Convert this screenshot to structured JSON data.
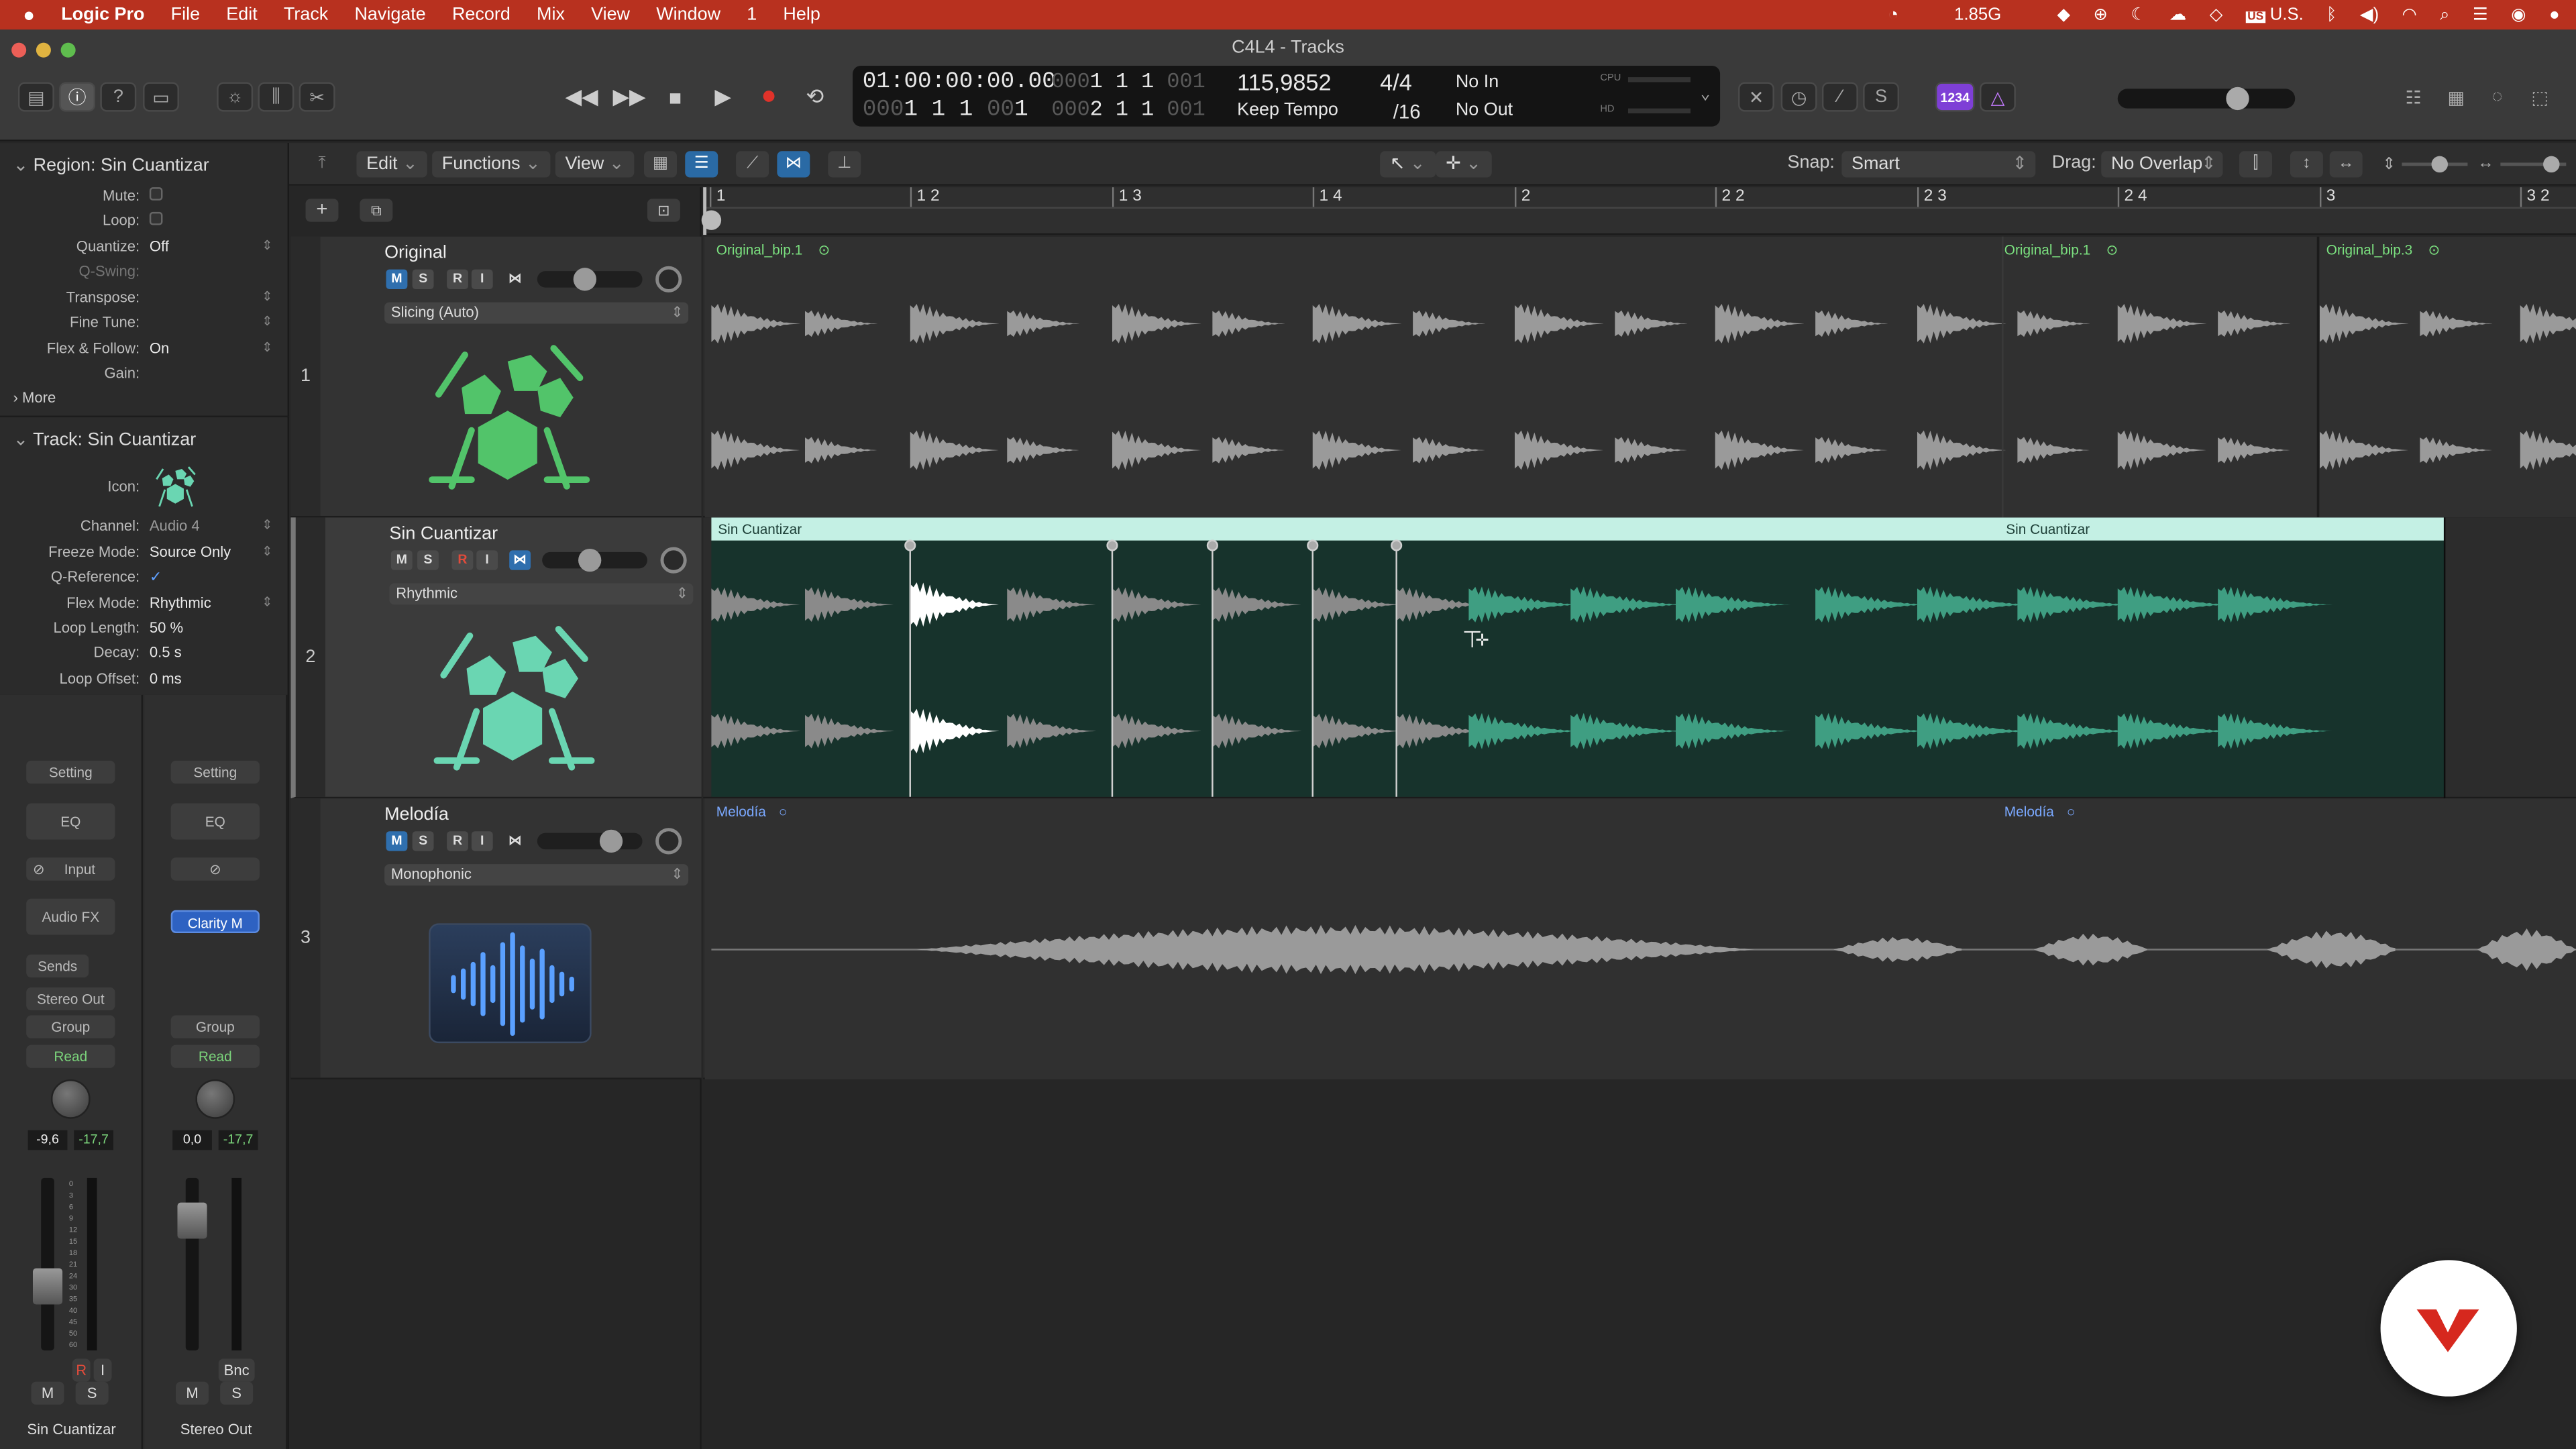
{
  "menubar": {
    "apple": "",
    "app": "Logic Pro",
    "items": [
      "File",
      "Edit",
      "Track",
      "Navigate",
      "Record",
      "Mix",
      "View",
      "Window",
      "1",
      "Help"
    ],
    "memory": "1.85G",
    "input_source": "U.S."
  },
  "window": {
    "title": "C4L4 - Tracks"
  },
  "lcd": {
    "time": "01:00:00:00.00",
    "bars_top": "1  1  1",
    "bars_top_dim": "000",
    "bars_top_tail": "001",
    "bars_bottom": "1  1  1",
    "bars_bottom_dim": "000",
    "bars_bottom_tail": "1",
    "pos2_dim": "000",
    "pos2": "2  1  1",
    "pos2_tail": "001",
    "pos2b_dim": "000",
    "pos2b": "1  1  1",
    "pos2b_tail": "001",
    "tempo": "115,9852",
    "tempo_mode": "Keep Tempo",
    "signature": "4/4",
    "division": "/16",
    "in": "No In",
    "out": "No Out",
    "cpu": "CPU",
    "hd": "HD"
  },
  "lcd_badge": "1234",
  "toolbar": {
    "edit": "Edit",
    "functions": "Functions",
    "view": "View",
    "snap_label": "Snap:",
    "snap_value": "Smart",
    "drag_label": "Drag:",
    "drag_value": "No Overlap"
  },
  "inspector": {
    "region_header": "Region: Sin Cuantizar",
    "region_params": [
      {
        "label": "Mute:",
        "value": ""
      },
      {
        "label": "Loop:",
        "value": ""
      },
      {
        "label": "Quantize:",
        "value": "Off"
      },
      {
        "label": "Q-Swing:",
        "value": ""
      },
      {
        "label": "Transpose:",
        "value": ""
      },
      {
        "label": "Fine Tune:",
        "value": ""
      },
      {
        "label": "Flex & Follow:",
        "value": "On"
      },
      {
        "label": "Gain:",
        "value": ""
      }
    ],
    "more": "More",
    "track_header": "Track: Sin Cuantizar",
    "track_params": [
      {
        "label": "Icon:",
        "value": ""
      },
      {
        "label": "Channel:",
        "value": "Audio 4"
      },
      {
        "label": "Freeze Mode:",
        "value": "Source Only"
      },
      {
        "label": "Q-Reference:",
        "value": "✓"
      },
      {
        "label": "Flex Mode:",
        "value": "Rhythmic"
      },
      {
        "label": "Loop Length:",
        "value": "50 %"
      },
      {
        "label": "Decay:",
        "value": "0.5 s"
      },
      {
        "label": "Loop Offset:",
        "value": "0 ms"
      }
    ]
  },
  "strips": [
    {
      "setting": "Setting",
      "eq": "EQ",
      "input": "Input",
      "fx": "Audio FX",
      "sends": "Sends",
      "output": "Stereo Out",
      "group": "Group",
      "automation": "Read",
      "vol": "-9,6",
      "peak": "-17,7",
      "r": "R",
      "i": "I",
      "m": "M",
      "s": "S",
      "name": "Sin Cuantizar"
    },
    {
      "setting": "Setting",
      "eq": "EQ",
      "plugin": "Clarity M",
      "group": "Group",
      "automation": "Read",
      "vol": "0,0",
      "peak": "-17,7",
      "bnc": "Bnc",
      "m": "M",
      "s": "S",
      "name": "Stereo Out"
    }
  ],
  "meter_scale": [
    "0",
    "3",
    "6",
    "9",
    "12",
    "15",
    "18",
    "21",
    "24",
    "30",
    "35",
    "40",
    "45",
    "50",
    "60"
  ],
  "tracks": [
    {
      "num": "1",
      "name": "Original",
      "m": "M",
      "s": "S",
      "r": "R",
      "i": "I",
      "flex": "Slicing (Auto)",
      "icon": "drum-kit-icon",
      "color": "#52c46a",
      "vol": 0.55
    },
    {
      "num": "2",
      "name": "Sin Cuantizar",
      "m": "M",
      "s": "S",
      "r": "R",
      "i": "I",
      "flex": "Rhythmic",
      "icon": "drum-kit-icon",
      "color": "#6ad6b2",
      "vol": 0.55
    },
    {
      "num": "3",
      "name": "Melodía",
      "m": "M",
      "s": "S",
      "r": "R",
      "i": "I",
      "flex": "Monophonic",
      "icon": "waveform-icon",
      "color": "#4a8ae0",
      "vol": 0.85
    }
  ],
  "ruler": {
    "bars": [
      "1",
      "1 2",
      "1 3",
      "1 4",
      "2",
      "2 2",
      "2 3",
      "2 4",
      "3",
      "3 2"
    ]
  },
  "regions": {
    "r1a": "Original_bip.1",
    "r1b": "Original_bip.1",
    "r1c": "Original_bip.3",
    "r2a": "Sin Cuantizar",
    "r2b": "Sin Cuantizar",
    "r3a": "Melodía",
    "r3b": "Melodía"
  },
  "colors": {
    "accent": "#2f6fae",
    "menubar": "#b8311f",
    "flex_region": "#c4f0e4",
    "melody_label": "#7aa8ff",
    "original_label": "#7be07f"
  }
}
